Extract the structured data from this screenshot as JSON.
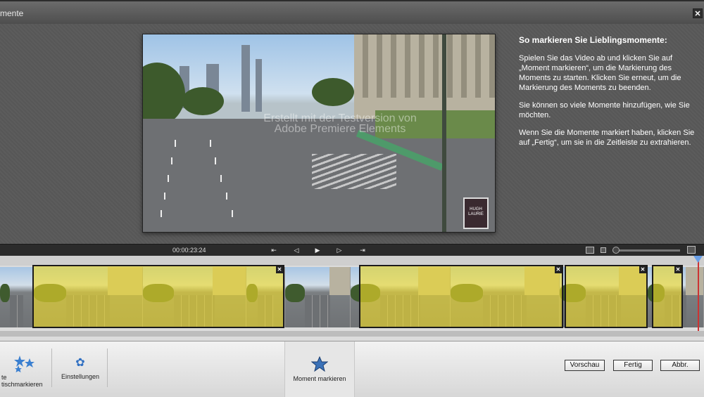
{
  "window": {
    "title": "mente",
    "close_glyph": "✕"
  },
  "video": {
    "watermark_line1": "Erstellt mit der Testversion von",
    "watermark_line2": "Adobe Premiere Elements",
    "sign_text": "HUGH LAURIE"
  },
  "instructions": {
    "title": "So markieren Sie Lieblingsmomente:",
    "paragraphs": [
      "Spielen Sie das Video ab und klicken Sie auf „Moment markieren“, um die Markierung des Moments zu starten. Klicken Sie erneut, um die Markierung des Moments zu beenden.",
      "Sie können so viele Momente hinzufügen, wie Sie möchten.",
      "Wenn Sie die Momente markiert haben, klicken Sie auf „Fertig“, um sie in die Zeitleiste zu extrahieren."
    ]
  },
  "transport": {
    "timecode": "00:00:23:24",
    "controls": [
      {
        "name": "go-to-start-icon",
        "glyph": "⇤"
      },
      {
        "name": "step-back-icon",
        "glyph": "◁"
      },
      {
        "name": "play-icon",
        "glyph": "▶"
      },
      {
        "name": "step-forward-icon",
        "glyph": "▷"
      },
      {
        "name": "go-to-end-icon",
        "glyph": "⇥"
      }
    ]
  },
  "moments": {
    "close_glyph": "✕",
    "count": 4
  },
  "bottombar": {
    "auto_mark_label_line1": "te",
    "auto_mark_label_line2": "tischmarkieren",
    "settings_label": "Einstellungen",
    "mark_moment_label": "Moment markieren",
    "preview_label": "Vorschau",
    "done_label": "Fertig",
    "cancel_label": "Abbr."
  },
  "colors": {
    "moment_fill": "#f0dc28",
    "accent_blue": "#2f6fc2",
    "playhead": "#cc3333"
  }
}
